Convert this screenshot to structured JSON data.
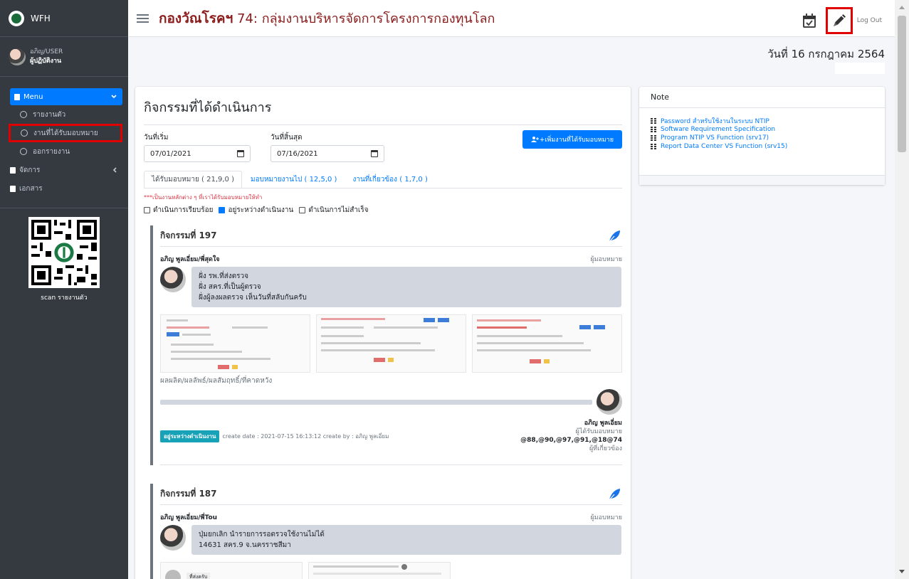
{
  "brand": {
    "name": "WFH"
  },
  "user": {
    "name": "อภิญ/USER",
    "role": "ผู้ปฏิบัติงาน"
  },
  "sidebar": {
    "menu_label": "Menu",
    "items": [
      {
        "label": "รายงานตัว"
      },
      {
        "label": "งานที่ได้รับมอบหมาย"
      },
      {
        "label": "ออกรายงาน"
      }
    ],
    "groups": [
      {
        "label": "จัดการ"
      },
      {
        "label": "เอกสาร"
      }
    ],
    "qr_caption": "scan รายงานตัว"
  },
  "header": {
    "title_main": "กองวัณโรคฯ",
    "title_sub": " 74: กลุ่มงานบริหารจัดการโครงการกองทุนโลก",
    "logout": "Log Out"
  },
  "date_display": "วันที่ 16 กรกฎาคม 2564",
  "main": {
    "title": "กิจกรรมที่ได้ดำเนินการ",
    "start_label": "วันที่เริ่ม",
    "start_value": "07/01/2021",
    "end_label": "วันที่สิ้นสุด",
    "end_value": "07/16/2021",
    "add_button": "+เพิ่มงานที่ได้รับมอบหมาย",
    "tabs": [
      {
        "label": "ได้รับมอบหมาย ( 21,9,0 )"
      },
      {
        "label": "มอบหมายงานไป ( 12,5,0 )"
      },
      {
        "label": "งานที่เกี่ยวข้อง ( 1,7,0 )"
      }
    ],
    "note": "***เป็นงานหลักต่าง ๆ ที่เราได้รับมอบหมายให้ทำ",
    "filters": [
      {
        "label": "ดำเนินการเรียบร้อย",
        "checked": false
      },
      {
        "label": "อยู่ระหว่างดำเนินงาน",
        "checked": true
      },
      {
        "label": "ดำเนินการไม่สำเร็จ",
        "checked": false
      }
    ],
    "activities": [
      {
        "title": "กิจกรรมที่ 197",
        "from": "อภิญ พูลเอี่ยม/พี่สุดใจ",
        "from_role": "ผู้มอบหมาย",
        "lines": [
          "ฝั่ง รพ.ที่ส่งตรวจ",
          "ฝั่ง สคร.ที่เป็นผู้ตรวจ",
          "ฝั่งผู้ลงผลตรวจ เห็นวันที่สลับกันครับ"
        ],
        "result_label": "ผลผลิต/ผลลัพธ์/ผลสัมฤทธิ์/ที่คาดหวัง",
        "status": "อยู่ระหว่างดำเนินงาน",
        "created": "create date : 2021-07-15 16:13:12 create by : อภิญ พูลเอี่ยม",
        "assignee": "อภิญ พูลเอี่ยม",
        "assignee_role": "ผู้ได้รับมอบหมาย",
        "related": "@88,@90,@97,@91,@18@74",
        "related_role": "ผู้ที่เกี่ยวข้อง"
      },
      {
        "title": "กิจกรรมที่ 187",
        "from": "อภิญ พูลเอี่ยม/พี่Tou",
        "from_role": "ผู้มอบหมาย",
        "lines": [
          "ปุ่มยกเลิก นำรายการรอตรวจใช้งานไม่ได้",
          "14631 สคร.9 จ.นครราชสีมา"
        ],
        "thumb_label": "ที่ส่งครับ"
      }
    ]
  },
  "note_card": {
    "title": "Note",
    "links": [
      {
        "label": "Password สำหรับใช้งานในระบบ NTIP"
      },
      {
        "label": "Software Requirement Specification"
      },
      {
        "label": "Program NTIP VS Function (srv17)"
      },
      {
        "label": "Report Data Center VS Function (srv15)"
      }
    ]
  },
  "colors": {
    "accent": "#007bff",
    "sidebar": "#343a40",
    "title": "#8b1a1a",
    "highlight": "#e00000",
    "badge": "#17a2b8"
  }
}
